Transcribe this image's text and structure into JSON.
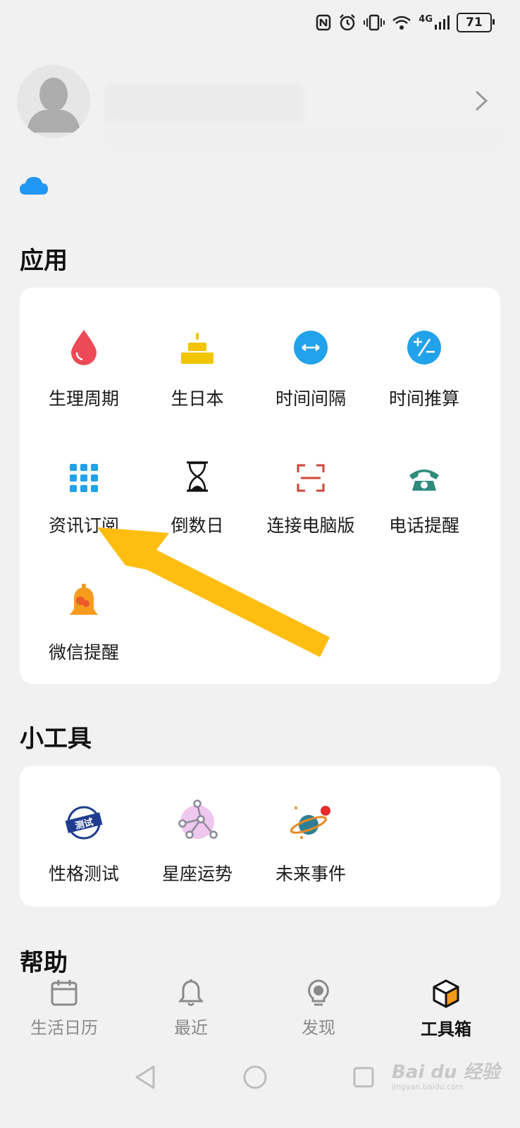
{
  "status_bar": {
    "battery": "71",
    "network": "4G"
  },
  "profile": {
    "chevron_icon": "chevron-right-icon",
    "cloud_icon": "cloud-icon"
  },
  "apps": {
    "title": "应用",
    "items": [
      {
        "label": "生理周期",
        "icon": "drop-icon"
      },
      {
        "label": "生日本",
        "icon": "cake-icon"
      },
      {
        "label": "时间间隔",
        "icon": "interval-icon"
      },
      {
        "label": "时间推算",
        "icon": "plus-minus-icon"
      },
      {
        "label": "资讯订阅",
        "icon": "grid-icon"
      },
      {
        "label": "倒数日",
        "icon": "hourglass-icon"
      },
      {
        "label": "连接电脑版",
        "icon": "scan-icon"
      },
      {
        "label": "电话提醒",
        "icon": "phone-icon"
      },
      {
        "label": "微信提醒",
        "icon": "bell-icon"
      }
    ]
  },
  "tools": {
    "title": "小工具",
    "items": [
      {
        "label": "性格测试",
        "icon": "test-stamp-icon",
        "stamp_text": "测试"
      },
      {
        "label": "星座运势",
        "icon": "constellation-icon"
      },
      {
        "label": "未来事件",
        "icon": "planet-icon"
      }
    ]
  },
  "help": {
    "title": "帮助"
  },
  "tabbar": {
    "tabs": [
      {
        "label": "生活日历",
        "icon": "calendar-icon",
        "active": false
      },
      {
        "label": "最近",
        "icon": "bell-outline-icon",
        "active": false
      },
      {
        "label": "发现",
        "icon": "bulb-icon",
        "active": false
      },
      {
        "label": "工具箱",
        "icon": "box-icon",
        "active": true
      }
    ]
  },
  "watermark": {
    "text": "Bai du 经验",
    "sub": "jingyan.baidu.com"
  },
  "colors": {
    "background": "#f2f1f1",
    "card": "#ffffff",
    "blue": "#22a2ea",
    "red": "#ec4a57",
    "yellow": "#f2c500",
    "arrow": "#ffbd10"
  }
}
